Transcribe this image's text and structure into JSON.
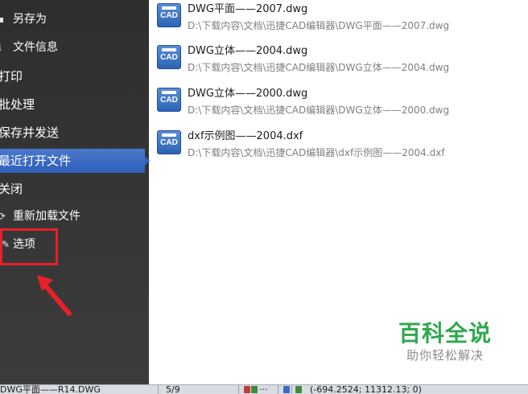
{
  "menu": {
    "items": [
      {
        "label": "另存为",
        "icon": "save-as-icon"
      },
      {
        "label": "文件信息",
        "icon": "info-icon"
      },
      {
        "label": "打印"
      },
      {
        "label": "批处理"
      },
      {
        "label": "保存并发送"
      },
      {
        "label": "最近打开文件",
        "selected": true
      },
      {
        "label": "关闭"
      },
      {
        "label": "重新加载文件",
        "icon": "reload-icon"
      },
      {
        "label": "选项",
        "icon": "options-icon",
        "highlighted": true
      }
    ]
  },
  "recent_files": [
    {
      "name": "DWG平面——2007.dwg",
      "path": "D:\\下载内容\\文档\\迅捷CAD编辑器\\DWG平面——2007.dwg",
      "icon_text": "CAD"
    },
    {
      "name": "DWG立体——2004.dwg",
      "path": "D:\\下载内容\\文档\\迅捷CAD编辑器\\DWG立体——2004.dwg",
      "icon_text": "CAD"
    },
    {
      "name": "DWG立体——2000.dwg",
      "path": "D:\\下载内容\\文档\\迅捷CAD编辑器\\DWG立体——2000.dwg",
      "icon_text": "CAD"
    },
    {
      "name": "dxf示例图——2004.dxf",
      "path": "D:\\下载内容\\文档\\迅捷CAD编辑器\\dxf示例图——2004.dxf",
      "icon_text": "CAD"
    }
  ],
  "watermark": {
    "title": "百科全说",
    "subtitle": "助你轻松解决"
  },
  "statusbar": {
    "document": "DWG平面——R14.DWG",
    "page": "5/9",
    "dots": "···",
    "coords": "(-694.2524; 11312.13; 0)"
  },
  "colors": {
    "selected": "#3a6cc4",
    "highlight": "#e8202a",
    "watermark": "#2fa84f",
    "file_icon": "#2b62b3"
  }
}
